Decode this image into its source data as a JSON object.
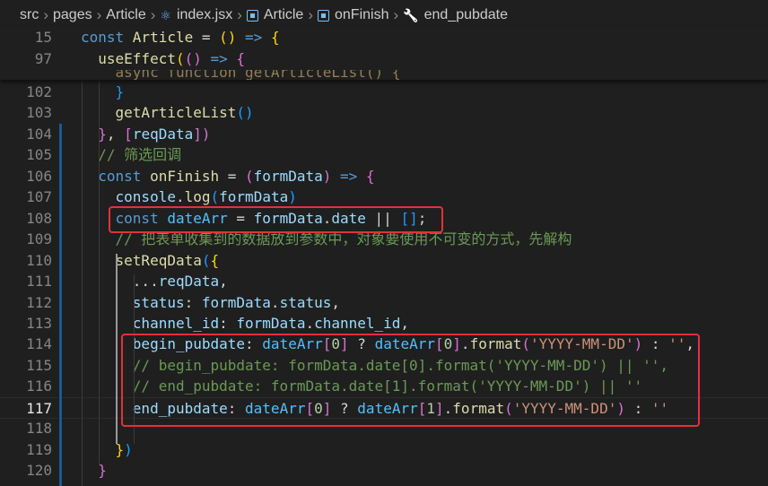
{
  "breadcrumb": {
    "items": [
      {
        "label": "src",
        "icon": ""
      },
      {
        "label": "pages",
        "icon": ""
      },
      {
        "label": "Article",
        "icon": ""
      },
      {
        "label": "index.jsx",
        "icon": "react-icon"
      },
      {
        "label": "Article",
        "icon": "symbol-method-icon"
      },
      {
        "label": "onFinish",
        "icon": "symbol-method-icon"
      },
      {
        "label": "end_pubdate",
        "icon": "wrench-icon"
      }
    ]
  },
  "sticky_lines": [
    {
      "number": "15",
      "tokens": [
        [
          "kw",
          "const "
        ],
        [
          "fn",
          "Article"
        ],
        [
          "plain",
          " = "
        ],
        [
          "p1",
          "()"
        ],
        [
          "plain",
          " "
        ],
        [
          "kw",
          "=>"
        ],
        [
          "plain",
          " "
        ],
        [
          "p1",
          "{"
        ]
      ]
    },
    {
      "number": "97",
      "tokens": [
        [
          "plain",
          "  "
        ],
        [
          "fn",
          "useEffect"
        ],
        [
          "p1",
          "("
        ],
        [
          "p2",
          "()"
        ],
        [
          "plain",
          " "
        ],
        [
          "kw",
          "=>"
        ],
        [
          "plain",
          " "
        ],
        [
          "p2",
          "{"
        ]
      ]
    }
  ],
  "ghost_line": "    async function getArticleList() {",
  "lines": [
    {
      "number": "102",
      "tokens": [
        [
          "plain",
          "    "
        ],
        [
          "p3",
          "}"
        ]
      ]
    },
    {
      "number": "103",
      "tokens": [
        [
          "plain",
          "    "
        ],
        [
          "fn",
          "getArticleList"
        ],
        [
          "p3",
          "()"
        ]
      ]
    },
    {
      "number": "104",
      "tokens": [
        [
          "plain",
          "  "
        ],
        [
          "p2",
          "}"
        ],
        [
          "plain",
          ", "
        ],
        [
          "p2",
          "["
        ],
        [
          "var",
          "reqData"
        ],
        [
          "p2",
          "])"
        ]
      ]
    },
    {
      "number": "105",
      "tokens": [
        [
          "plain",
          "  "
        ],
        [
          "cmt",
          "// 筛选回调"
        ]
      ]
    },
    {
      "number": "106",
      "tokens": [
        [
          "plain",
          "  "
        ],
        [
          "kw",
          "const "
        ],
        [
          "fn",
          "onFinish"
        ],
        [
          "plain",
          " = "
        ],
        [
          "p2",
          "("
        ],
        [
          "var",
          "formData"
        ],
        [
          "p2",
          ")"
        ],
        [
          "plain",
          " "
        ],
        [
          "kw",
          "=>"
        ],
        [
          "plain",
          " "
        ],
        [
          "p2",
          "{"
        ]
      ]
    },
    {
      "number": "107",
      "tokens": [
        [
          "plain",
          "    "
        ],
        [
          "var",
          "console"
        ],
        [
          "plain",
          "."
        ],
        [
          "fn",
          "log"
        ],
        [
          "p3",
          "("
        ],
        [
          "var",
          "formData"
        ],
        [
          "p3",
          ")"
        ]
      ]
    },
    {
      "number": "108",
      "tokens": [
        [
          "plain",
          "    "
        ],
        [
          "kw",
          "const "
        ],
        [
          "const",
          "dateArr"
        ],
        [
          "plain",
          " = "
        ],
        [
          "var",
          "formData"
        ],
        [
          "plain",
          "."
        ],
        [
          "var",
          "date"
        ],
        [
          "plain",
          " || "
        ],
        [
          "p3",
          "[]"
        ],
        [
          "plain",
          ";"
        ]
      ]
    },
    {
      "number": "109",
      "tokens": [
        [
          "plain",
          "    "
        ],
        [
          "cmt",
          "// 把表单收集到的数据放到参数中，对象要使用不可变的方式，先解构"
        ]
      ]
    },
    {
      "number": "110",
      "tokens": [
        [
          "plain",
          "    "
        ],
        [
          "fn",
          "setReqData"
        ],
        [
          "p3",
          "("
        ],
        [
          "p1",
          "{"
        ]
      ]
    },
    {
      "number": "111",
      "tokens": [
        [
          "plain",
          "      ..."
        ],
        [
          "var",
          "reqData"
        ],
        [
          "plain",
          ","
        ]
      ]
    },
    {
      "number": "112",
      "tokens": [
        [
          "plain",
          "      "
        ],
        [
          "var",
          "status"
        ],
        [
          "plain",
          ": "
        ],
        [
          "var",
          "formData"
        ],
        [
          "plain",
          "."
        ],
        [
          "var",
          "status"
        ],
        [
          "plain",
          ","
        ]
      ]
    },
    {
      "number": "113",
      "tokens": [
        [
          "plain",
          "      "
        ],
        [
          "var",
          "channel_id"
        ],
        [
          "plain",
          ": "
        ],
        [
          "var",
          "formData"
        ],
        [
          "plain",
          "."
        ],
        [
          "var",
          "channel_id"
        ],
        [
          "plain",
          ","
        ]
      ]
    },
    {
      "number": "114",
      "tokens": [
        [
          "plain",
          "      "
        ],
        [
          "var",
          "begin_pubdate"
        ],
        [
          "plain",
          ": "
        ],
        [
          "const",
          "dateArr"
        ],
        [
          "p2",
          "["
        ],
        [
          "num",
          "0"
        ],
        [
          "p2",
          "]"
        ],
        [
          "plain",
          " ? "
        ],
        [
          "const",
          "dateArr"
        ],
        [
          "p2",
          "["
        ],
        [
          "num",
          "0"
        ],
        [
          "p2",
          "]"
        ],
        [
          "plain",
          "."
        ],
        [
          "fn",
          "format"
        ],
        [
          "p2",
          "("
        ],
        [
          "str",
          "'YYYY-MM-DD'"
        ],
        [
          "p2",
          ")"
        ],
        [
          "plain",
          " : "
        ],
        [
          "str",
          "''"
        ],
        [
          "plain",
          ","
        ]
      ]
    },
    {
      "number": "115",
      "tokens": [
        [
          "plain",
          "      "
        ],
        [
          "cmt",
          "// begin_pubdate: formData.date[0].format('YYYY-MM-DD') || '',"
        ]
      ]
    },
    {
      "number": "116",
      "tokens": [
        [
          "plain",
          "      "
        ],
        [
          "cmt",
          "// end_pubdate: formData.date[1].format('YYYY-MM-DD') || ''"
        ]
      ]
    },
    {
      "number": "117",
      "tokens": [
        [
          "plain",
          "      "
        ],
        [
          "var",
          "end_pubdate"
        ],
        [
          "plain",
          ": "
        ],
        [
          "const",
          "dateArr"
        ],
        [
          "p2",
          "["
        ],
        [
          "num",
          "0"
        ],
        [
          "p2",
          "]"
        ],
        [
          "plain",
          " ? "
        ],
        [
          "const",
          "dateArr"
        ],
        [
          "p2",
          "["
        ],
        [
          "num",
          "1"
        ],
        [
          "p2",
          "]"
        ],
        [
          "plain",
          "."
        ],
        [
          "fn",
          "format"
        ],
        [
          "p2",
          "("
        ],
        [
          "str",
          "'YYYY-MM-DD'"
        ],
        [
          "p2",
          ")"
        ],
        [
          "plain",
          " : "
        ],
        [
          "str",
          "''"
        ]
      ]
    },
    {
      "number": "118",
      "tokens": []
    },
    {
      "number": "119",
      "tokens": [
        [
          "plain",
          "    "
        ],
        [
          "p1",
          "}"
        ],
        [
          "p3",
          ")"
        ]
      ]
    },
    {
      "number": "120",
      "tokens": [
        [
          "plain",
          "  "
        ],
        [
          "p2",
          "}"
        ]
      ]
    }
  ],
  "active_line": "117",
  "highlight_boxes": [
    {
      "lines": [
        "108"
      ],
      "color": "#e5303a"
    },
    {
      "lines": [
        "114",
        "115",
        "116",
        "117"
      ],
      "color": "#e5303a"
    }
  ]
}
